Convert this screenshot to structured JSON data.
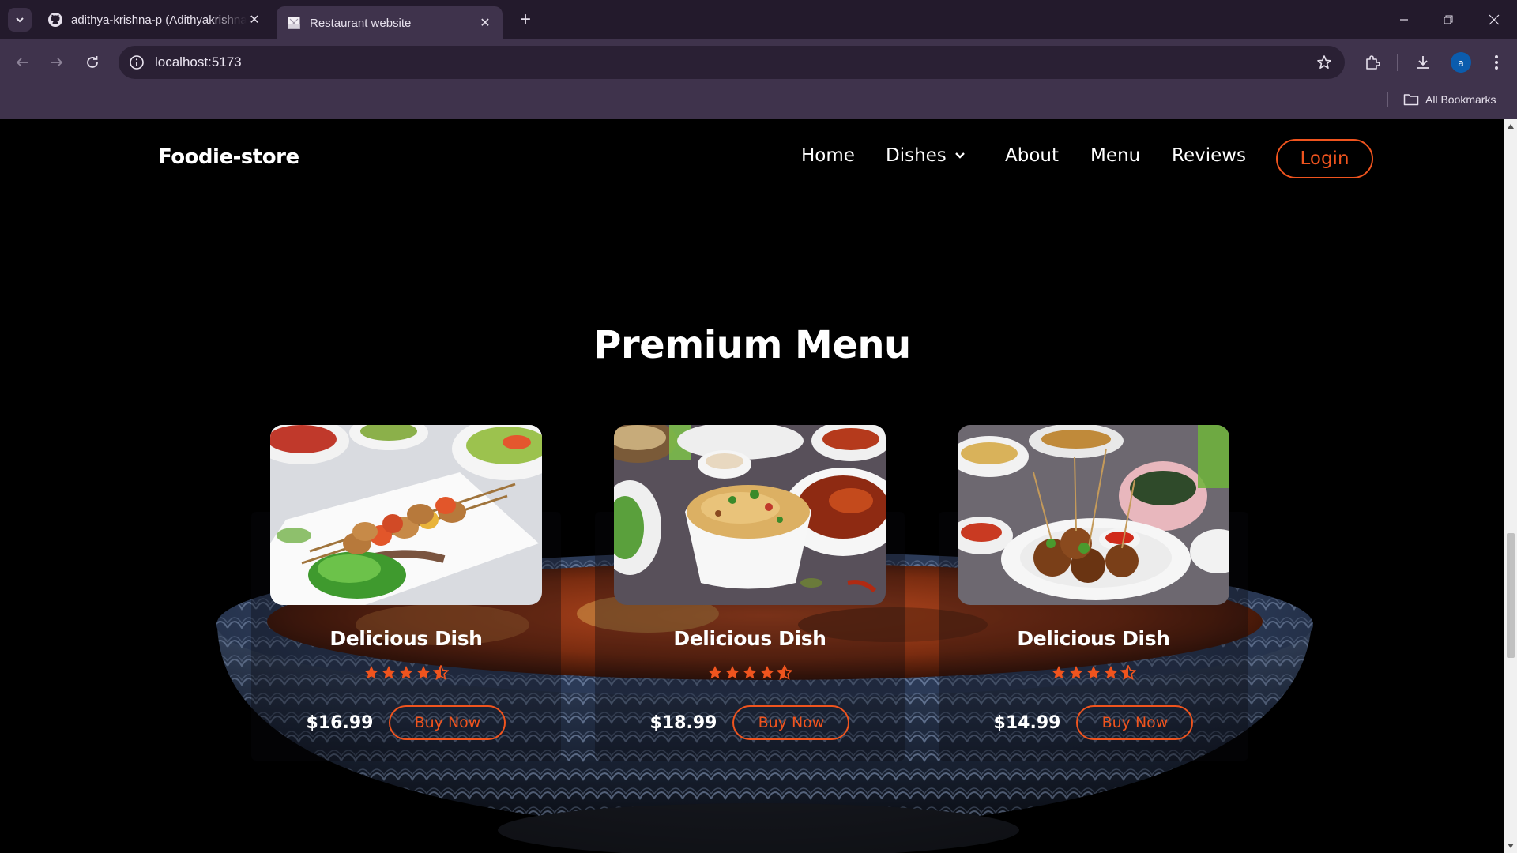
{
  "browser": {
    "tabs": [
      {
        "title": "adithya-krishna-p (Adithyakrishna",
        "icon": "github-icon",
        "active": false
      },
      {
        "title": "Restaurant website",
        "icon": "page-icon",
        "active": true
      }
    ],
    "url": "localhost:5173",
    "profile_initial": "a",
    "bookmarks_label": "All Bookmarks"
  },
  "site": {
    "logo": "Foodie-store",
    "nav": {
      "home": "Home",
      "dishes": "Dishes",
      "about": "About",
      "menu": "Menu",
      "reviews": "Reviews",
      "login": "Login"
    },
    "accent_color": "#f0541e",
    "section_title": "Premium Menu",
    "cards": [
      {
        "name": "Delicious Dish",
        "rating": 4.5,
        "price": "$16.99",
        "button": "Buy Now",
        "image": "chicken-skewers-plate"
      },
      {
        "name": "Delicious Dish",
        "rating": 4.5,
        "price": "$18.99",
        "button": "Buy Now",
        "image": "biryani-bowl"
      },
      {
        "name": "Delicious Dish",
        "rating": 4.5,
        "price": "$14.99",
        "button": "Buy Now",
        "image": "meatballs-plate"
      }
    ]
  }
}
